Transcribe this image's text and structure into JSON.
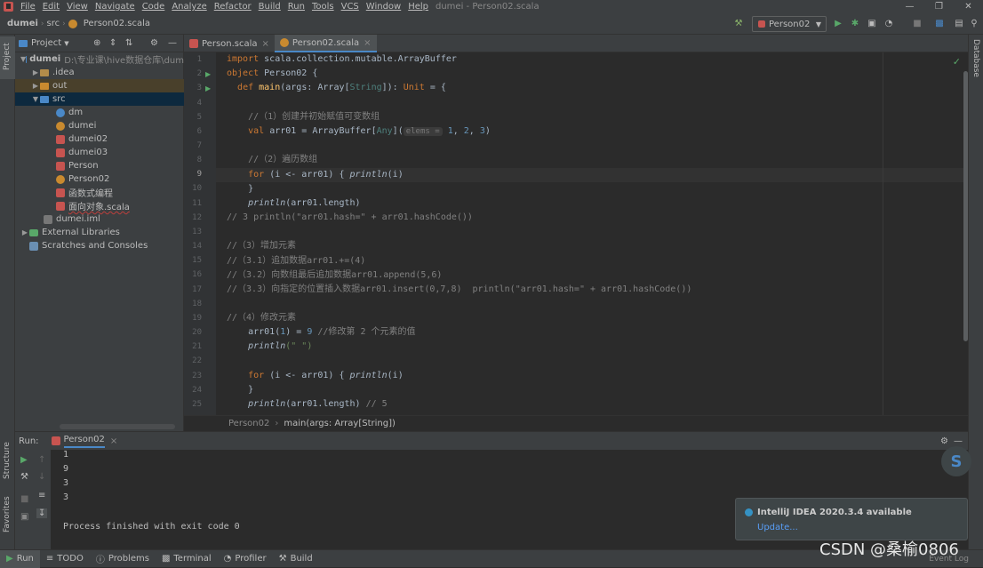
{
  "menu": {
    "items": [
      "File",
      "Edit",
      "View",
      "Navigate",
      "Code",
      "Analyze",
      "Refactor",
      "Build",
      "Run",
      "Tools",
      "VCS",
      "Window",
      "Help"
    ],
    "title": "dumei - Person02.scala"
  },
  "nav": {
    "crumbs": [
      "dumei",
      "src",
      "Person02.scala"
    ],
    "run_config": "Person02"
  },
  "left_strip": {
    "project": "Project",
    "structure": "Structure",
    "favorites": "Favorites"
  },
  "right_strip": {
    "database": "Database"
  },
  "project": {
    "header": "Project",
    "tree": [
      {
        "label": "dumei",
        "extra": "D:\\专业课\\hive数据仓库\\dum"
      },
      {
        "label": ".idea"
      },
      {
        "label": "out"
      },
      {
        "label": "src"
      },
      {
        "label": "dm"
      },
      {
        "label": "dumei"
      },
      {
        "label": "dumei02"
      },
      {
        "label": "dumei03"
      },
      {
        "label": "Person"
      },
      {
        "label": "Person02"
      },
      {
        "label": "函数式编程"
      },
      {
        "label": "面向对象.scala"
      },
      {
        "label": "dumei.iml"
      },
      {
        "label": "External Libraries"
      },
      {
        "label": "Scratches and Consoles"
      }
    ]
  },
  "tabs": [
    {
      "label": "Person.scala"
    },
    {
      "label": "Person02.scala"
    }
  ],
  "line_numbers": [
    "1",
    "2",
    "3",
    "4",
    "5",
    "6",
    "7",
    "8",
    "9",
    "10",
    "11",
    "12",
    "13",
    "14",
    "15",
    "16",
    "17",
    "18",
    "19",
    "20",
    "21",
    "22",
    "23",
    "24",
    "25"
  ],
  "code": {
    "l1": "scala.collection.mutable.ArrayBuffer",
    "l2": "Person02 {",
    "l3a": "main",
    "l3b": "(args: Array[",
    "l3c": "String",
    "l3d": "]): ",
    "l3e": "Unit",
    "l3f": " = {",
    "l5": "//（1）创建并初始赋值可变数组",
    "l6a": "arr01 = ArrayBuffer[",
    "l6b": "Any",
    "l6c": "](",
    "l6hint": "elems =",
    "l6d": "1",
    "l6e": ", ",
    "l6f": "2",
    "l6g": ", ",
    "l6h": "3",
    "l6i": ")",
    "l8": "//（2）遍历数组",
    "l9a": "(i <- arr01) { ",
    "l9b": "println",
    "l9c": "(i)",
    "l10": "}",
    "l11a": "println",
    "l11b": "(arr01.length)",
    "l12": "// 3 println(\"arr01.hash=\" + arr01.hashCode())",
    "l14": "//（3）增加元素",
    "l15": "//（3.1）追加数据arr01.+=(4)",
    "l16": "//（3.2）向数组最后追加数据arr01.append(5,6)",
    "l17": "//（3.3）向指定的位置插入数据arr01.insert(0,7,8)  println(\"arr01.hash=\" + arr01.hashCode())",
    "l19": "//（4）修改元素",
    "l20a": "arr01(",
    "l20b": "1",
    "l20c": ") = ",
    "l20d": "9",
    "l20e": " //修改第 2 个元素的值",
    "l21a": "println",
    "l21b": "(\" \")",
    "l23a": "(i <- arr01) { ",
    "l23b": "println",
    "l23c": "(i)",
    "l24": "}",
    "l25a": "println",
    "l25b": "(arr01.length) ",
    "l25c": "// 5",
    "kw_import": "import",
    "kw_object": "object",
    "kw_def": "def",
    "kw_val": "val",
    "kw_for": "for"
  },
  "breadcrumb": {
    "a": "Person02",
    "b": "main(args: Array[String])"
  },
  "run": {
    "label": "Run:",
    "tab": "Person02",
    "output": [
      "1",
      "9",
      "3",
      "3",
      "",
      "Process finished with exit code 0"
    ]
  },
  "notification": {
    "title": "IntelliJ IDEA 2020.3.4 available",
    "link": "Update..."
  },
  "statusbar": {
    "items": [
      "Run",
      "TODO",
      "Problems",
      "Terminal",
      "Profiler",
      "Build"
    ],
    "event_log": "Event Log"
  },
  "watermark": "CSDN @桑榆0806"
}
